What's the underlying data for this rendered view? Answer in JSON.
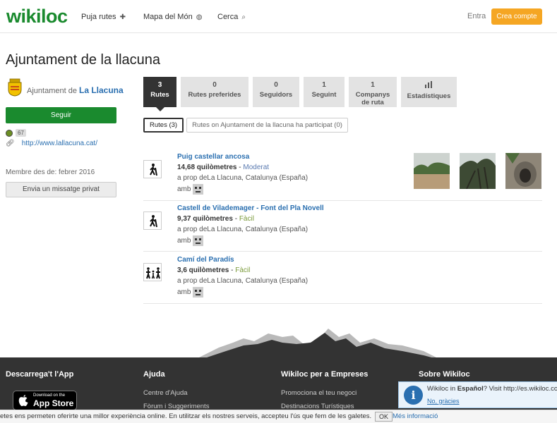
{
  "header": {
    "logo": "wikiloc",
    "nav": [
      {
        "label": "Puja rutes",
        "icon": "plus-icon",
        "glyph": "✚"
      },
      {
        "label": "Mapa del Món",
        "icon": "globe-icon",
        "glyph": "◍"
      },
      {
        "label": "Cerca",
        "icon": "search-icon",
        "glyph": "⌕"
      }
    ],
    "login": "Entra",
    "signup": "Crea compte"
  },
  "page_title": "Ajuntament de la llacuna",
  "sidebar": {
    "org_prefix": "Ajuntament de",
    "org_name": "La Llacuna",
    "follow_button": "Seguir",
    "score": "67",
    "website": "http://www.lallacuna.cat/",
    "member_since": "Membre des de: febrer 2016",
    "message_button": "Envia un missatge privat"
  },
  "tabs": [
    {
      "num": "3",
      "label": "Rutes",
      "active": true
    },
    {
      "num": "0",
      "label": "Rutes preferides",
      "active": false
    },
    {
      "num": "0",
      "label": "Seguidors",
      "active": false
    },
    {
      "num": "1",
      "label": "Seguint",
      "active": false
    },
    {
      "num": "1",
      "label": "Companys de ruta",
      "active": false
    },
    {
      "num": "",
      "label": "Estadístiques",
      "active": false
    }
  ],
  "subtabs": [
    {
      "label": "Rutes (3)",
      "active": true
    },
    {
      "label": "Rutes on Ajuntament de la llacuna ha participat (0)",
      "active": false
    }
  ],
  "routes": [
    {
      "title": "Puig castellar ancosa",
      "distance": "14,68 quilòmetres",
      "difficulty": "Moderat",
      "near": "a prop deLa Llacuna, Catalunya (España)",
      "with": "amb",
      "activity_icon": "hiking-icon"
    },
    {
      "title": "Castell de Vilademager - Font del Pla Novell",
      "distance": "9,37 quilòmetres",
      "difficulty": "Fàcil",
      "near": "a prop deLa Llacuna, Catalunya (España)",
      "with": "amb",
      "activity_icon": "hiking-icon"
    },
    {
      "title": "Camí del Paradís",
      "distance": "3,6 quilòmetres",
      "difficulty": "Fàcil",
      "near": "a prop deLa Llacuna, Catalunya (España)",
      "with": "amb",
      "activity_icon": "family-icon"
    }
  ],
  "footer": {
    "columns": [
      {
        "title": "Descarrega't l'App",
        "links": []
      },
      {
        "title": "Ajuda",
        "links": [
          "Centre d'Ajuda",
          "Fòrum i Suggeriments"
        ]
      },
      {
        "title": "Wikiloc per a Empreses",
        "links": [
          "Promociona el teu negoci",
          "Destinacions Turístiques"
        ]
      },
      {
        "title": "Sobre Wikiloc",
        "links": []
      }
    ],
    "appstore_small": "Download on the",
    "appstore_big": "App Store"
  },
  "lang_popup": {
    "prefix": "Wikiloc in ",
    "lang": "Español",
    "suffix": "? Visit http://es.wikiloc.co",
    "dismiss": "No, gràcies"
  },
  "cookie": {
    "text": "etes ens permeten oferirte una millor experiència online. En utilitzar els nostres serveis, accepteu l'ús que fem de les galetes.",
    "ok": "OK",
    "more": "Més informació"
  },
  "colors": {
    "brand_green": "#1a8a2e",
    "signup_orange": "#f5a623",
    "link_blue": "#2a6fb0"
  }
}
